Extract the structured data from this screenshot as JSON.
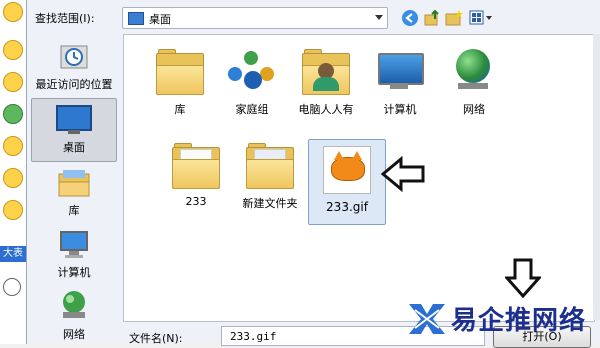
{
  "dialog": {
    "look_in_label": "查找范围(I):",
    "look_in_value": "桌面",
    "nav": [
      {
        "label": "最近访问的位置",
        "icon": "recent-places-icon"
      },
      {
        "label": "桌面",
        "icon": "desktop-icon",
        "selected": true
      },
      {
        "label": "库",
        "icon": "library-icon"
      },
      {
        "label": "计算机",
        "icon": "computer-icon"
      },
      {
        "label": "网络",
        "icon": "network-icon"
      }
    ],
    "files": [
      {
        "label": "库",
        "icon": "library-folder-icon"
      },
      {
        "label": "家庭组",
        "icon": "homegroup-icon"
      },
      {
        "label": "电脑人人有",
        "icon": "user-folder-icon"
      },
      {
        "label": "计算机",
        "icon": "computer-icon"
      },
      {
        "label": "网络",
        "icon": "network-icon"
      },
      {
        "label": "233",
        "icon": "folder-icon"
      },
      {
        "label": "新建文件夹",
        "icon": "folder-icon"
      },
      {
        "label": "233.gif",
        "icon": "gif-image-icon",
        "selected": true
      }
    ],
    "filename_label": "文件名(N):",
    "filename_value": "233.gif",
    "open_button": "打开(O)"
  },
  "background": {
    "strip_text": "大表"
  },
  "watermark": {
    "text": "易企推网络"
  },
  "colors": {
    "brand": "#1c2f8c",
    "selection": "#dde8f6",
    "accent": "#3b7fd4"
  }
}
